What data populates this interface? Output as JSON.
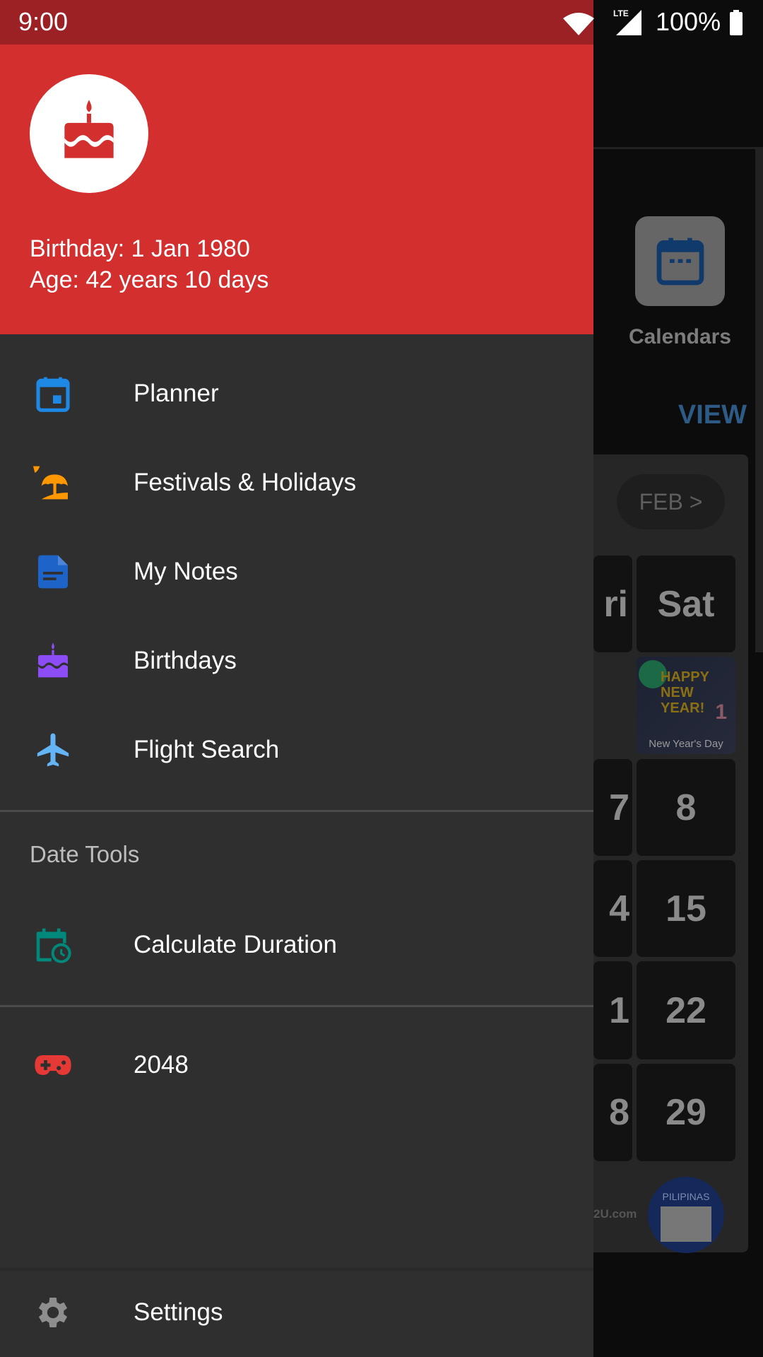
{
  "status_bar": {
    "time": "9:00",
    "network": "LTE",
    "battery": "100%",
    "icons": [
      "wifi-icon",
      "signal-icon",
      "battery-icon"
    ]
  },
  "drawer": {
    "header": {
      "icon": "birthday-cake-icon",
      "color": "#d32f2f",
      "birthday": "Birthday: 1 Jan 1980",
      "age": "Age: 42 years 10 days"
    },
    "items": [
      {
        "label": "Planner",
        "icon": "calendar-icon",
        "color": "#1e88e5"
      },
      {
        "label": "Festivals & Holidays",
        "icon": "beach-umbrella-icon",
        "color": "#ff9800"
      },
      {
        "label": "My Notes",
        "icon": "note-icon",
        "color": "#1e63c7"
      },
      {
        "label": "Birthdays",
        "icon": "cake-icon",
        "color": "#8c4df7"
      },
      {
        "label": "Flight Search",
        "icon": "airplane-icon",
        "color": "#64b5f6"
      }
    ],
    "section": "Date Tools",
    "tools": [
      {
        "label": "Calculate Duration",
        "icon": "calendar-clock-icon",
        "color": "#00897b"
      }
    ],
    "games": [
      {
        "label": "2048",
        "icon": "gamepad-icon",
        "color": "#e53935"
      }
    ],
    "footer": {
      "label": "Settings",
      "icon": "gear-icon"
    }
  },
  "background": {
    "calendars_label": "Calendars",
    "view_label": "VIEW",
    "next_month": "FEB >",
    "day_header_partial": "ri",
    "day_header": "Sat",
    "holiday": {
      "day": "1",
      "name": "New Year's Day",
      "banner": "HAPPY NEW YEAR!"
    },
    "rows": [
      {
        "left": "7",
        "right": "8"
      },
      {
        "left": "4",
        "right": "15"
      },
      {
        "left": "1",
        "right": "22"
      },
      {
        "left": "8",
        "right": "29"
      }
    ],
    "footer_site": "2U.com",
    "badge": "PILIPINAS"
  }
}
